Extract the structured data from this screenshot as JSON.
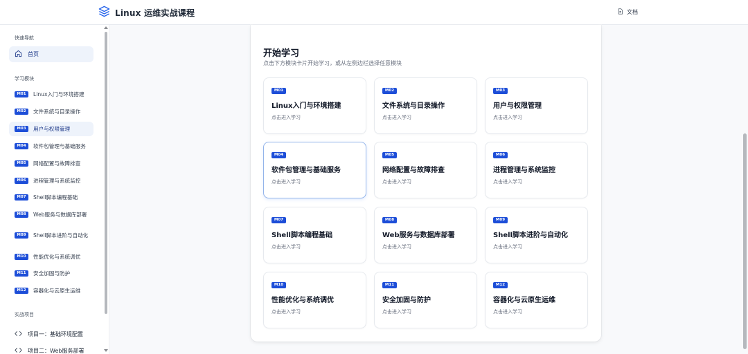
{
  "header": {
    "title": "Linux 运维实战课程",
    "docs_label": "文档"
  },
  "sidebar": {
    "quick_nav_title": "快速导航",
    "home_label": "首页",
    "modules_title": "学习模块",
    "modules": [
      {
        "badge": "M01",
        "label": "Linux入门与环境搭建"
      },
      {
        "badge": "M02",
        "label": "文件系统与目录操作"
      },
      {
        "badge": "M03",
        "label": "用户与权限管理"
      },
      {
        "badge": "M04",
        "label": "软件包管理与基础服务"
      },
      {
        "badge": "M05",
        "label": "网络配置与故障排查"
      },
      {
        "badge": "M06",
        "label": "进程管理与系统监控"
      },
      {
        "badge": "M07",
        "label": "Shell脚本编程基础"
      },
      {
        "badge": "M08",
        "label": "Web服务与数据库部署"
      },
      {
        "badge": "M09",
        "label": "Shell脚本进阶与自动化"
      },
      {
        "badge": "M10",
        "label": "性能优化与系统调优"
      },
      {
        "badge": "M11",
        "label": "安全加固与防护"
      },
      {
        "badge": "M12",
        "label": "容器化与云原生运维"
      }
    ],
    "active_module": "M03",
    "projects_title": "实战项目",
    "projects": [
      {
        "label": "项目一：基础环境配置"
      },
      {
        "label": "项目二：Web服务部署"
      }
    ]
  },
  "main": {
    "title": "开始学习",
    "subtitle": "点击下方模块卡片开始学习，或从左侧边栏选择任意模块",
    "card_hint": "点击进入学习",
    "hovered_card": "M04",
    "cards": [
      {
        "badge": "M01",
        "title": "Linux入门与环境搭建"
      },
      {
        "badge": "M02",
        "title": "文件系统与目录操作"
      },
      {
        "badge": "M03",
        "title": "用户与权限管理"
      },
      {
        "badge": "M04",
        "title": "软件包管理与基础服务"
      },
      {
        "badge": "M05",
        "title": "网络配置与故障排查"
      },
      {
        "badge": "M06",
        "title": "进程管理与系统监控"
      },
      {
        "badge": "M07",
        "title": "Shell脚本编程基础"
      },
      {
        "badge": "M08",
        "title": "Web服务与数据库部署"
      },
      {
        "badge": "M09",
        "title": "Shell脚本进阶与自动化"
      },
      {
        "badge": "M10",
        "title": "性能优化与系统调优"
      },
      {
        "badge": "M11",
        "title": "安全加固与防护"
      },
      {
        "badge": "M12",
        "title": "容器化与云原生运维"
      }
    ]
  },
  "colors": {
    "accent": "#1d4ed8",
    "active_bg": "#eef3fb",
    "hover_border": "#93b4ea"
  }
}
